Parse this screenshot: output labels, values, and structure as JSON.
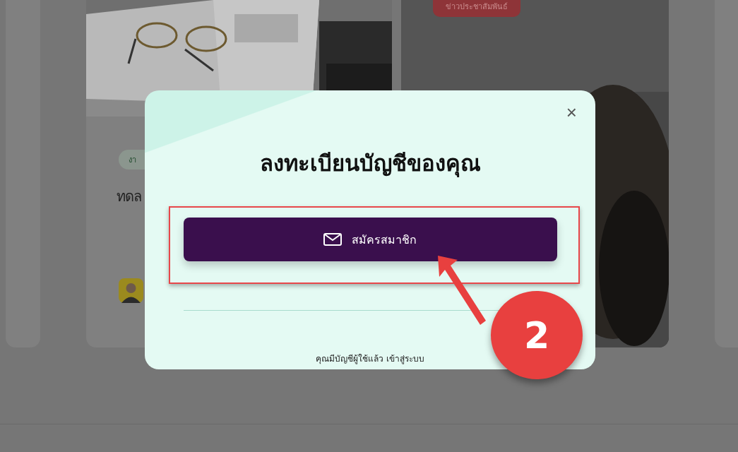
{
  "page": {
    "cards": [
      {
        "kind": "edge"
      },
      {
        "kind": "article",
        "tag": "งา",
        "title": "ทดล"
      },
      {
        "tag": "ข่าวประชาสัมพันธ์"
      },
      {
        "kind": "edge"
      }
    ]
  },
  "modal": {
    "close": "×",
    "title": "ลงทะเบียนบัญชีของคุณ",
    "signup_button": "สมัครสมาชิก",
    "footer_text": "คุณมีบัญชีผู้ใช้แล้ว",
    "login_link": "เข้าสู่ระบบ"
  },
  "annotation": {
    "step_number": "2"
  }
}
